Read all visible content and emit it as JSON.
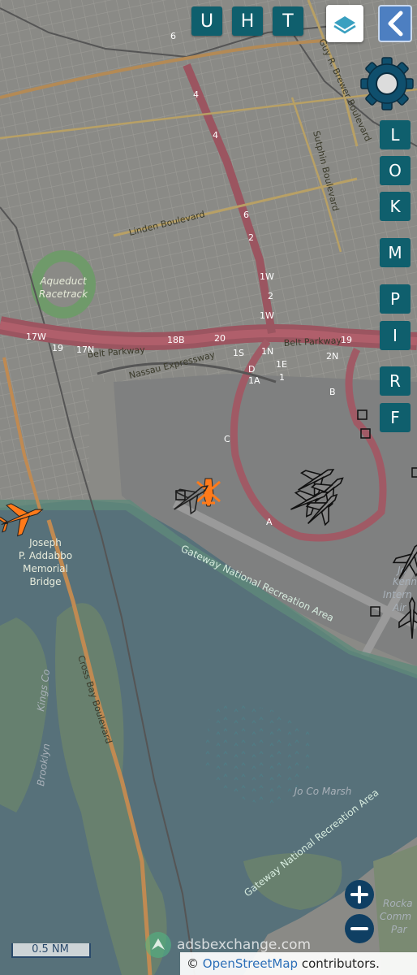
{
  "top_buttons": [
    {
      "key": "U"
    },
    {
      "key": "H"
    },
    {
      "key": "T"
    }
  ],
  "side_buttons": [
    {
      "key": "L"
    },
    {
      "key": "O"
    },
    {
      "key": "K"
    },
    {
      "key": "M"
    },
    {
      "key": "P"
    },
    {
      "key": "I"
    },
    {
      "key": "R"
    },
    {
      "key": "F"
    }
  ],
  "map_labels": {
    "aqueduct_racetrack": [
      "Aqueduct",
      "Racetrack"
    ],
    "linden_blvd": "Linden Boulevard",
    "belt_parkway_1": "Belt Parkway",
    "belt_parkway_2": "Belt Parkway",
    "nassau_expwy": "Nassau Expressway",
    "guy_brewer": "Guy R. Brewer Boulevard",
    "sutphin": "Sutphin Boulevard",
    "bridge": [
      "Joseph",
      "P. Addabbo",
      "Memorial",
      "Bridge"
    ],
    "gateway_1": "Gateway National Recreation Area",
    "gateway_2": "Gateway National Recreation Area",
    "cross_bay": "Cross Bay Boulevard",
    "brooklyn": "Brooklyn",
    "kings": "Kings Co",
    "jo_co_marsh": "Jo Co Marsh",
    "intl_1": "Jo",
    "intl_2": "Kenn",
    "intl_3": "Intern",
    "intl_4": "Air",
    "rockaway_1": "Rocka",
    "rockaway_2": "Comm",
    "rockaway_3": "Par",
    "exit_17w": "17W",
    "exit_19a": "19",
    "exit_17n": "17N",
    "exit_18b": "18B",
    "exit_20": "20",
    "exit_1w_a": "1W",
    "exit_1w_b": "1W",
    "exit_1s": "1S",
    "exit_1n": "1N",
    "exit_1e": "1E",
    "exit_2n": "2N",
    "exit_19b": "19",
    "exit_1d": "D",
    "exit_1a": "1A",
    "exit_1": "1",
    "exit_b": "B",
    "exit_c": "C",
    "exit_a": "A",
    "exit_6a": "6",
    "exit_4a": "4",
    "exit_4b": "4",
    "exit_6b": "6",
    "exit_2": "2",
    "exit_2b": "2"
  },
  "scale": {
    "label": "0.5 NM"
  },
  "watermark": {
    "text": "adsbexchange.com"
  },
  "attribution": {
    "prefix": "©",
    "link": "OpenStreetMap",
    "suffix": "contributors."
  },
  "colors": {
    "button": "#0f5f6d",
    "selected_aircraft": "#ff7a1a",
    "aircraft_outline": "#222222",
    "zoom": "#0f3f63"
  }
}
